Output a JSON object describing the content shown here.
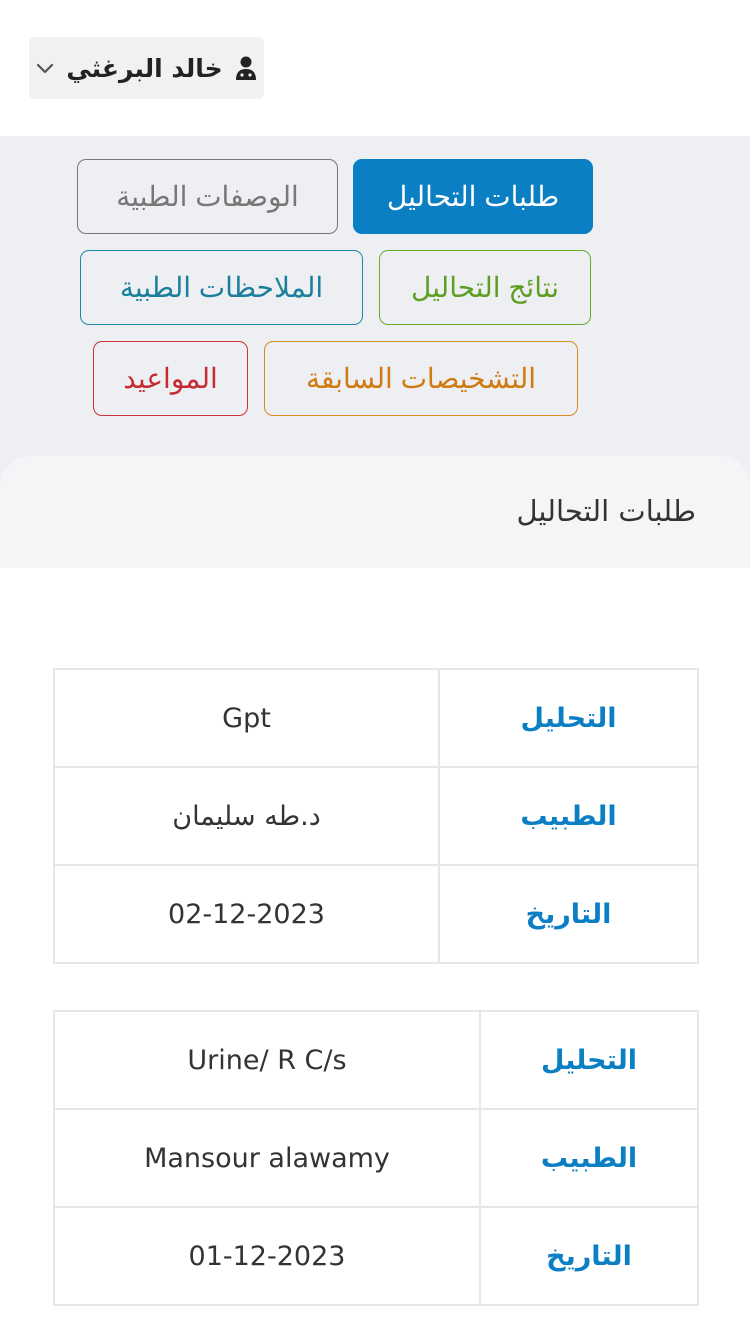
{
  "header": {
    "user_name": "خالد البرغثي",
    "user_icon": "user-doctor-icon",
    "dropdown_icon": "chevron-down-icon"
  },
  "tabs": [
    {
      "label": "طلبات التحاليل",
      "color": "#0a7fc4",
      "active": true
    },
    {
      "label": "الوصفات الطبية",
      "color": "#777777",
      "active": false
    },
    {
      "label": "نتائج التحاليل",
      "color": "#6aab2a",
      "active": false
    },
    {
      "label": "الملاحظات الطبية",
      "color": "#1a8aa6",
      "active": false
    },
    {
      "label": "التشخيصات السابقة",
      "color": "#d98a22",
      "active": false
    },
    {
      "label": "المواعيد",
      "color": "#d0303a",
      "active": false
    }
  ],
  "section": {
    "title": "طلبات التحاليل"
  },
  "records": [
    {
      "rows": [
        {
          "label": "التحليل",
          "value": "Gpt"
        },
        {
          "label": "الطبيب",
          "value": "د.طه سليمان"
        },
        {
          "label": "التاريخ",
          "value": "02-12-2023"
        }
      ]
    },
    {
      "rows": [
        {
          "label": "التحليل",
          "value": "Urine/ R C/s"
        },
        {
          "label": "الطبيب",
          "value": "Mansour alawamy"
        },
        {
          "label": "التاريخ",
          "value": "01-12-2023"
        }
      ]
    }
  ],
  "colors": {
    "accent": "#0a7fc4",
    "tabs_background": "#edeff2",
    "section_background": "#f4f5f7"
  }
}
